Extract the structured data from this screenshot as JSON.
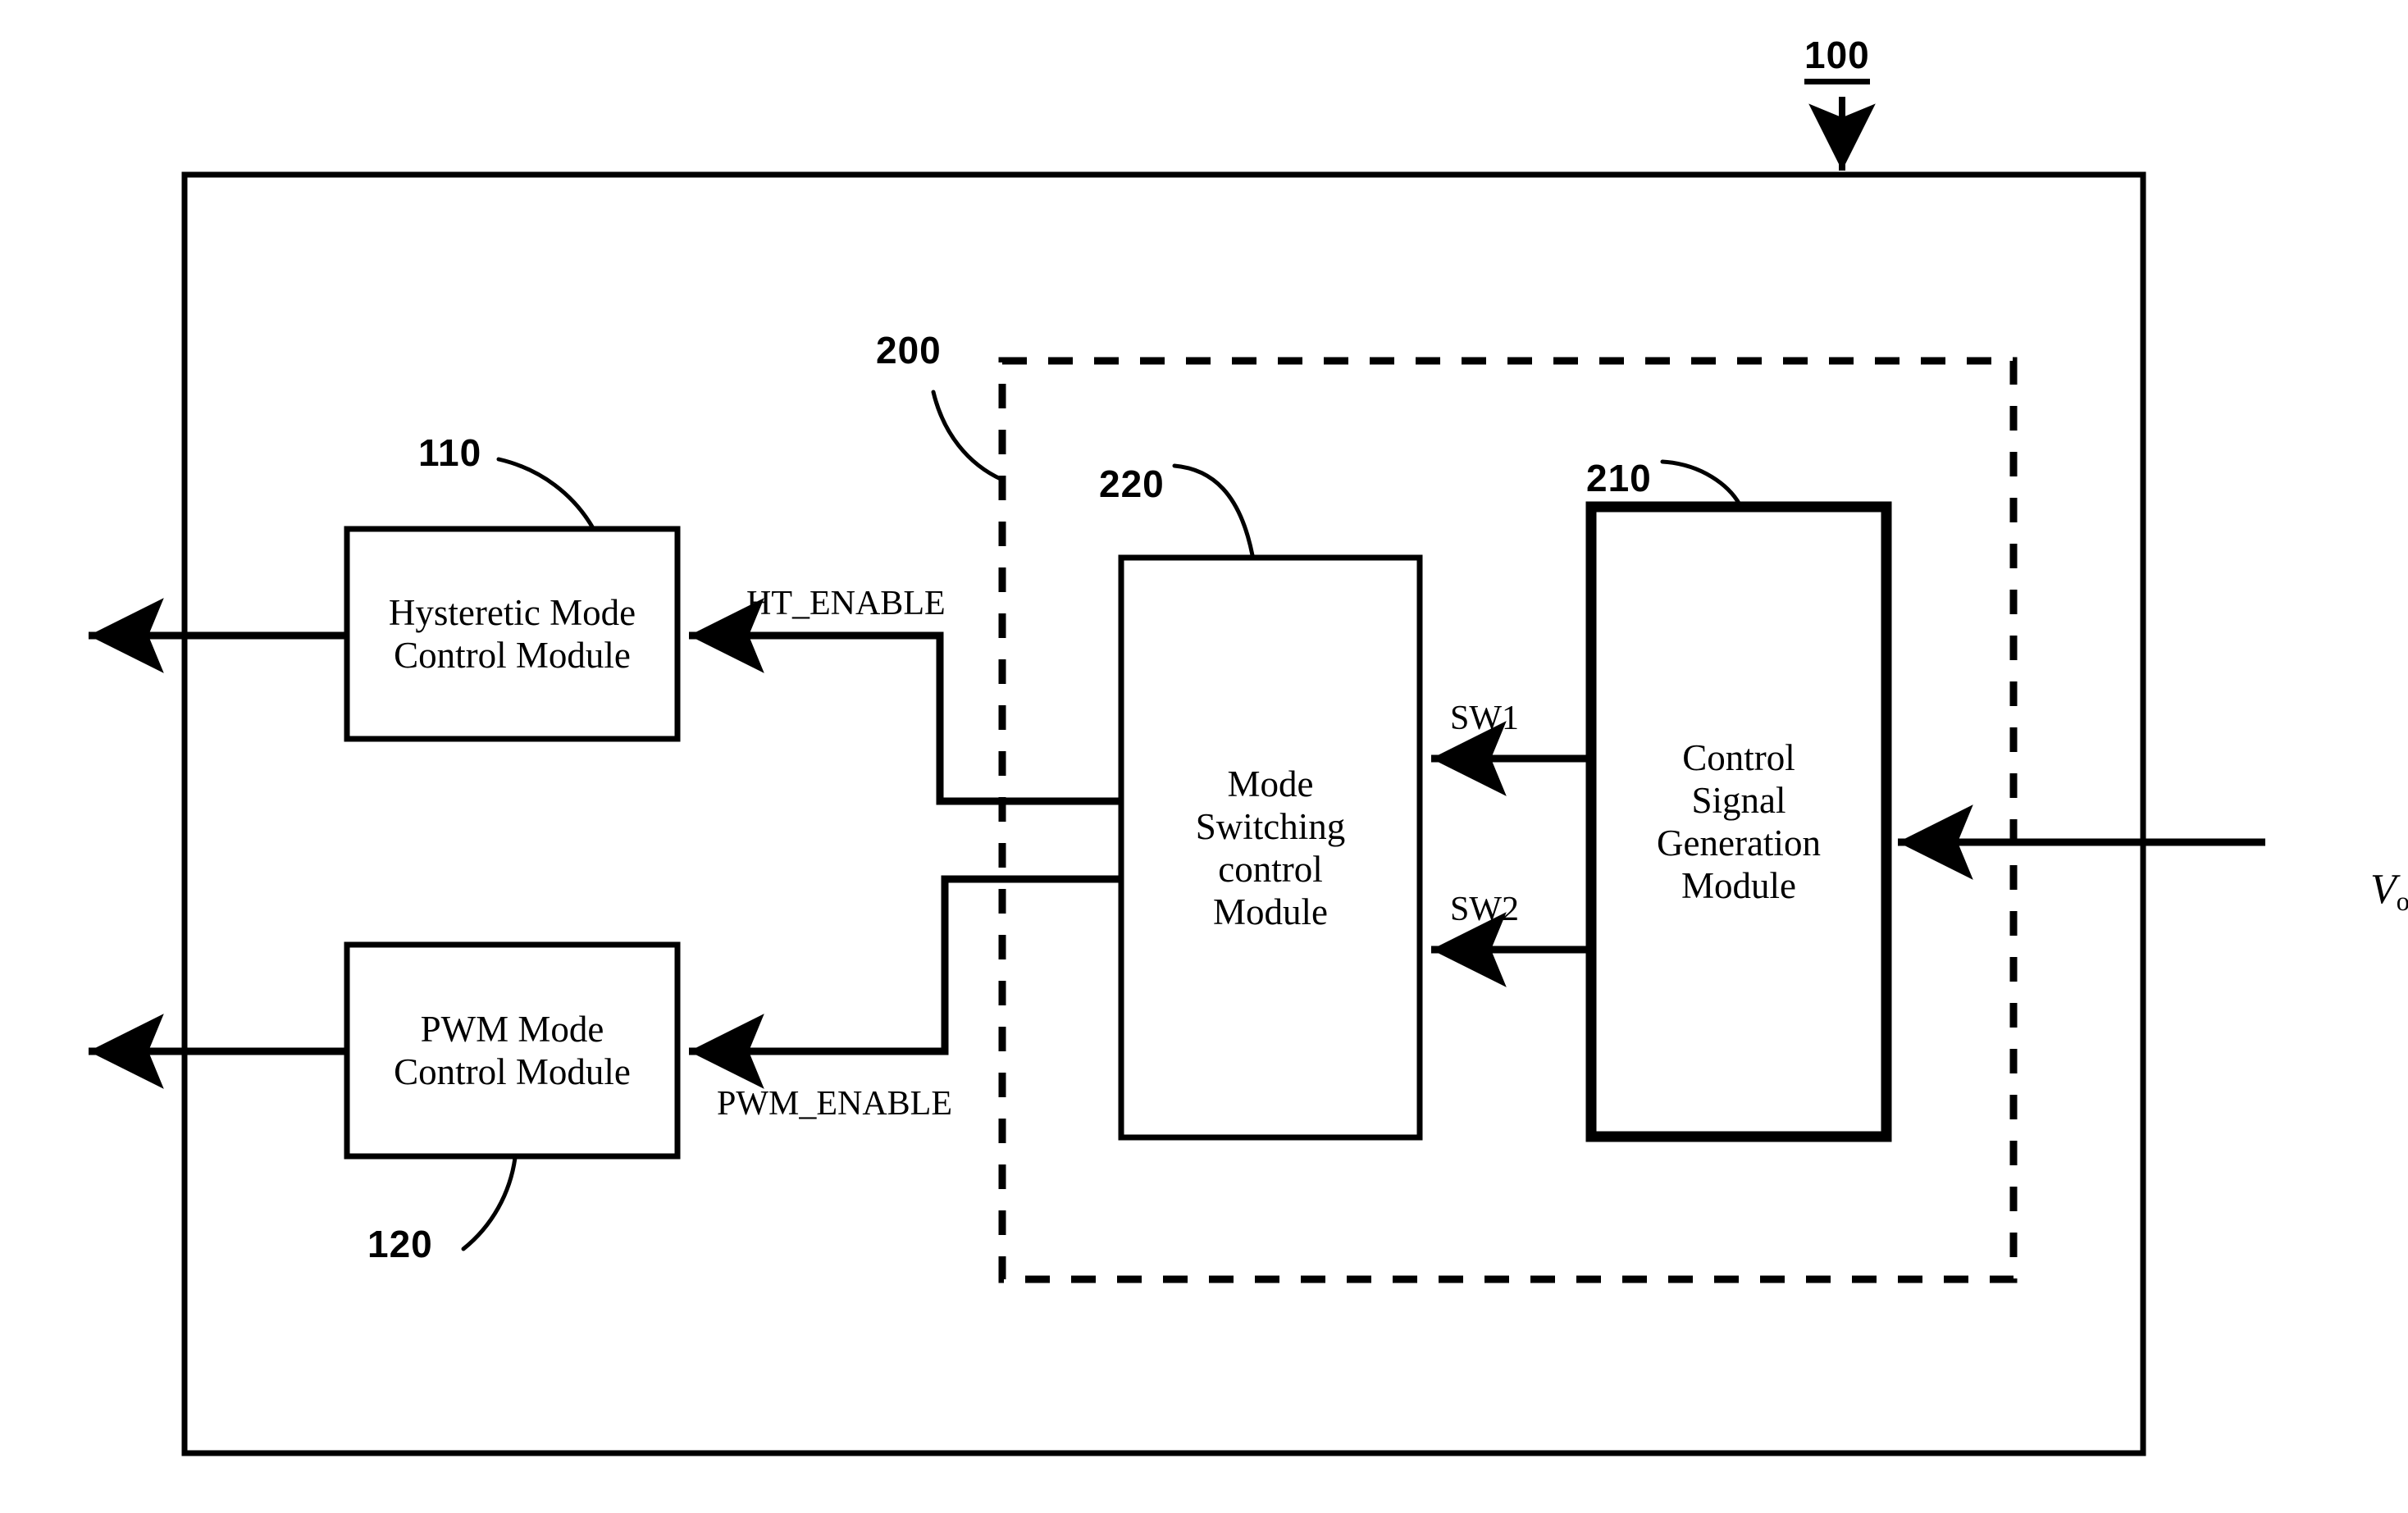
{
  "figure": {
    "type": "patent-block-diagram",
    "background_color": "#ffffff",
    "line_color": "#000000"
  },
  "reference_numerals": {
    "system": "100",
    "hysteretic_module": "110",
    "pwm_module": "120",
    "dashed_group": "200",
    "control_signal_generation": "210",
    "mode_switching": "220"
  },
  "blocks": {
    "hysteretic": {
      "line1": "Hysteretic Mode",
      "line2": "Control Module",
      "ref": "110"
    },
    "pwm": {
      "line1": "PWM Mode",
      "line2": "Control Module",
      "ref": "120"
    },
    "mode_switching": {
      "line1": "Mode",
      "line2": "Switching",
      "line3": "control",
      "line4": "Module",
      "ref": "220"
    },
    "control_signal": {
      "line1": "Control",
      "line2": "Signal",
      "line3": "Generation",
      "line4": "Module",
      "ref": "210"
    }
  },
  "signals": {
    "ht_enable": "HT_ENABLE",
    "pwm_enable": "PWM_ENABLE",
    "sw1": "SW1",
    "sw2": "SW2",
    "vo_symbol": "V",
    "vo_subscript": "o"
  }
}
